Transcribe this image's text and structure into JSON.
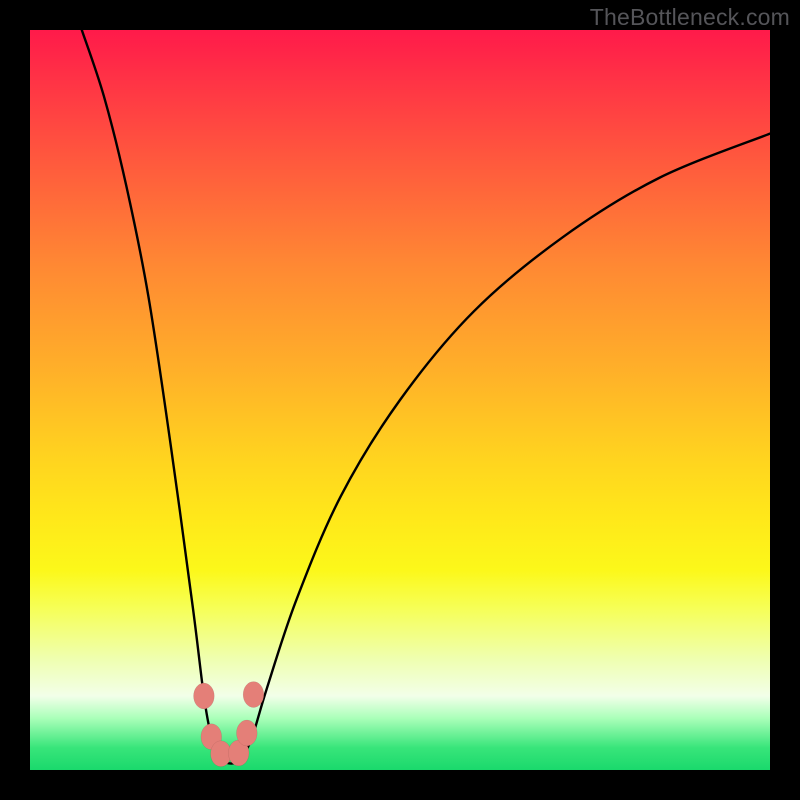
{
  "watermark": "TheBottleneck.com",
  "chart_data": {
    "type": "line",
    "title": "",
    "xlabel": "",
    "ylabel": "",
    "xlim": [
      0,
      100
    ],
    "ylim": [
      0,
      100
    ],
    "grid": false,
    "curve": {
      "description": "Bottleneck V-curve; minimum near x≈26, sharply rising each side",
      "points": [
        [
          7,
          100
        ],
        [
          10,
          91
        ],
        [
          13,
          79
        ],
        [
          16,
          64
        ],
        [
          19,
          44
        ],
        [
          22,
          22
        ],
        [
          23.5,
          10
        ],
        [
          24.5,
          4.5
        ],
        [
          25.5,
          1.8
        ],
        [
          26.5,
          1.0
        ],
        [
          27.8,
          1.0
        ],
        [
          29.0,
          2.2
        ],
        [
          30.2,
          5.0
        ],
        [
          32,
          11
        ],
        [
          36,
          23
        ],
        [
          42,
          37
        ],
        [
          50,
          50
        ],
        [
          60,
          62
        ],
        [
          72,
          72
        ],
        [
          85,
          80
        ],
        [
          100,
          86
        ]
      ]
    },
    "markers": {
      "description": "Pale-red rounded dots near the trough of the V",
      "points": [
        [
          23.5,
          10
        ],
        [
          24.5,
          4.5
        ],
        [
          25.8,
          2.2
        ],
        [
          28.2,
          2.3
        ],
        [
          29.3,
          5.0
        ],
        [
          30.2,
          10.2
        ]
      ],
      "radius": 1.4
    }
  }
}
